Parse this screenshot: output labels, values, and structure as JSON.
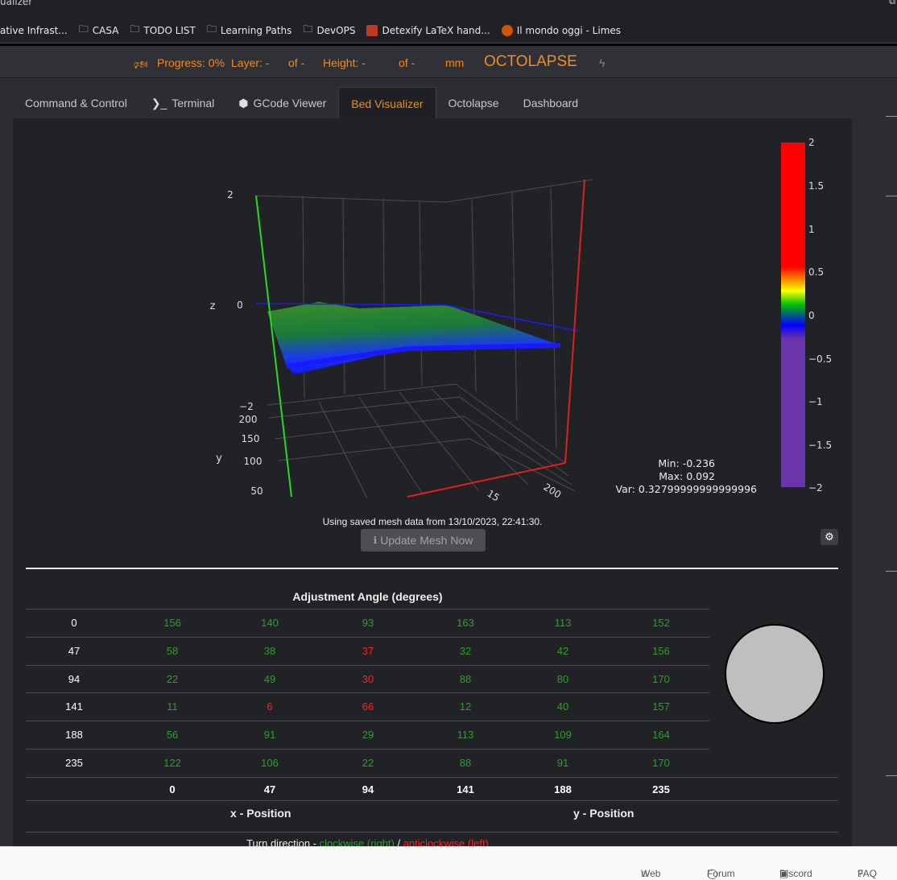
{
  "window": {
    "title": "ualizer",
    "corner_icon": "⧉"
  },
  "bookmarks": [
    {
      "label": "ative Infrast...",
      "icon": "none"
    },
    {
      "label": "CASA",
      "icon": "folder-icon"
    },
    {
      "label": "TODO LIST",
      "icon": "folder-icon"
    },
    {
      "label": "Learning Paths",
      "icon": "folder-icon"
    },
    {
      "label": "DevOPS",
      "icon": "folder-icon"
    },
    {
      "label": "Detexify LaTeX hand...",
      "icon": "detexify-icon"
    },
    {
      "label": "Il mondo oggi - Limes",
      "icon": "limes-icon"
    }
  ],
  "navbar": {
    "megaphone_icon": "🕬",
    "progress": "Progress: 0%",
    "layer": "Layer: -",
    "layer_of": "of -",
    "height": "Height: -",
    "height_of": "of -",
    "unit": "mm",
    "brand": "OCTOLAPSE",
    "bolt_icon": "ϟ",
    "accent": "#f08a24"
  },
  "tabs": [
    {
      "label": "Command & Control",
      "icon": ""
    },
    {
      "label": "Terminal",
      "icon": "❯_"
    },
    {
      "label": "GCode Viewer",
      "icon": "⬢"
    },
    {
      "label": "Bed Visualizer",
      "icon": "",
      "active": true
    },
    {
      "label": "Octolapse",
      "icon": ""
    },
    {
      "label": "Dashboard",
      "icon": ""
    }
  ],
  "plot": {
    "z_label": "z",
    "y_label": "y",
    "z_ticks": [
      "2",
      "0",
      "−2"
    ],
    "y_ticks": [
      "200",
      "150",
      "100",
      "50"
    ],
    "x_ticks": [
      "200",
      "15"
    ],
    "colorbar_ticks": [
      "2",
      "1.5",
      "1",
      "0.5",
      "0",
      "−0.5",
      "−1",
      "−1.5",
      "−2"
    ],
    "stats": {
      "min": "Min: -0.236",
      "max": "Max: 0.092",
      "var": "Var: 0.32799999999999996"
    }
  },
  "mesh": {
    "caption": "Using saved mesh data from 13/10/2023, 22:41:30.",
    "update_label": "Update Mesh Now",
    "info_icon": "ℹ",
    "gear_icon": "⚙"
  },
  "table": {
    "title": "Adjustment Angle (degrees)",
    "rows": [
      {
        "label": "0",
        "cells": [
          [
            "156",
            "g"
          ],
          [
            "140",
            "g"
          ],
          [
            "93",
            "g"
          ],
          [
            "163",
            "g"
          ],
          [
            "113",
            "g"
          ],
          [
            "152",
            "g"
          ]
        ]
      },
      {
        "label": "47",
        "cells": [
          [
            "58",
            "g"
          ],
          [
            "38",
            "g"
          ],
          [
            "37",
            "r"
          ],
          [
            "32",
            "g"
          ],
          [
            "42",
            "g"
          ],
          [
            "156",
            "g"
          ]
        ]
      },
      {
        "label": "94",
        "cells": [
          [
            "22",
            "g"
          ],
          [
            "49",
            "g"
          ],
          [
            "30",
            "r"
          ],
          [
            "88",
            "g"
          ],
          [
            "80",
            "g"
          ],
          [
            "170",
            "g"
          ]
        ]
      },
      {
        "label": "141",
        "cells": [
          [
            "11",
            "g"
          ],
          [
            "6",
            "r"
          ],
          [
            "66",
            "r"
          ],
          [
            "12",
            "g"
          ],
          [
            "40",
            "g"
          ],
          [
            "157",
            "g"
          ]
        ]
      },
      {
        "label": "188",
        "cells": [
          [
            "56",
            "g"
          ],
          [
            "91",
            "g"
          ],
          [
            "29",
            "g"
          ],
          [
            "113",
            "g"
          ],
          [
            "109",
            "g"
          ],
          [
            "164",
            "g"
          ]
        ]
      },
      {
        "label": "235",
        "cells": [
          [
            "122",
            "g"
          ],
          [
            "106",
            "g"
          ],
          [
            "22",
            "g"
          ],
          [
            "88",
            "g"
          ],
          [
            "91",
            "g"
          ],
          [
            "170",
            "g"
          ]
        ]
      }
    ],
    "x_positions": [
      "0",
      "47",
      "94",
      "141",
      "188",
      "235"
    ],
    "x_axis_label": "x - Position",
    "y_axis_label": "y - Position",
    "turn_prefix": "Turn direction - ",
    "turn_cw": "clockwise (right)",
    "turn_sep": " / ",
    "turn_ccw": "anticlockwise (left)"
  },
  "footer": [
    {
      "label": "Web",
      "icon": "⌂"
    },
    {
      "label": "Forum",
      "icon": "◯"
    },
    {
      "label": "Discord",
      "icon": "▣"
    },
    {
      "label": "FAQ",
      "icon": "?"
    }
  ]
}
